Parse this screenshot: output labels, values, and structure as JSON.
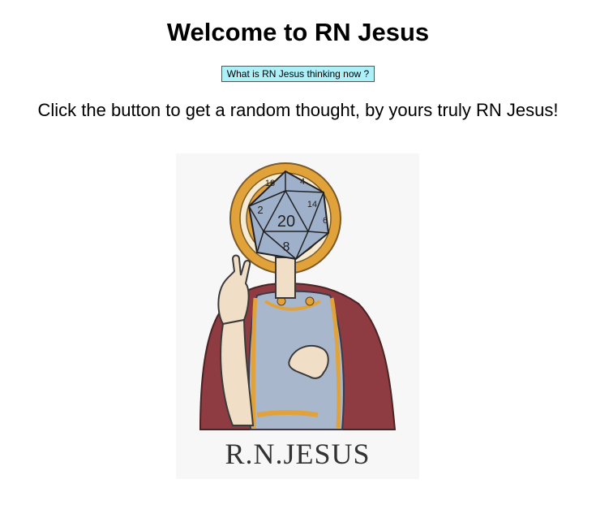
{
  "header": {
    "title": "Welcome to RN Jesus"
  },
  "action": {
    "button_label": "What is RN Jesus thinking now ?"
  },
  "intro": {
    "text": "Click the button to get a random thought, by yours truly RN Jesus!"
  },
  "illustration": {
    "caption": "R.N.JESUS",
    "die_numbers": {
      "center": "20",
      "bottom": "8",
      "left": "2",
      "top_left": "18",
      "top_right": "4",
      "right": "14",
      "far_right": "6"
    },
    "colors": {
      "halo": "#e2a23a",
      "halo_inner": "#f6ead0",
      "robe": "#a9b7cd",
      "cloak": "#8e3b42",
      "skin": "#f0dec6",
      "die": "#9fb0cb",
      "background": "#f7f7f7"
    }
  }
}
